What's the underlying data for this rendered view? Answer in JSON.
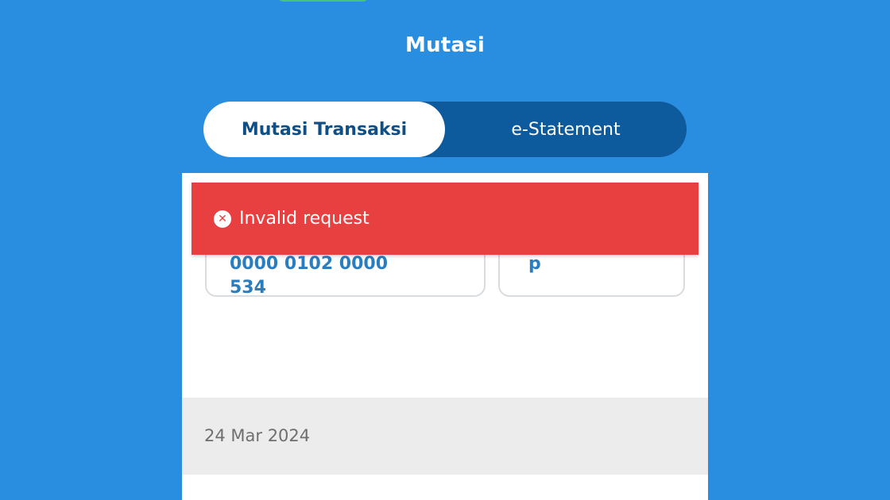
{
  "header": {
    "title": "Mutasi"
  },
  "tabs": [
    {
      "label": "Mutasi Transaksi",
      "active": true
    },
    {
      "label": "e-Statement",
      "active": false
    }
  ],
  "account_card": {
    "line1": "0000 0102 0000",
    "line2": "534"
  },
  "second_card": {
    "text": "p"
  },
  "date_group": {
    "label": "24 Mar 2024"
  },
  "toast": {
    "icon": "close-circle-icon",
    "glyph": "✕",
    "message": "Invalid request"
  },
  "colors": {
    "background": "#2a8ee0",
    "tab_track": "#0d5a9c",
    "tab_active_text": "#0f4f86",
    "toast_error": "#e84040",
    "account_text": "#2a7ebf",
    "date_bar": "#ececec"
  }
}
